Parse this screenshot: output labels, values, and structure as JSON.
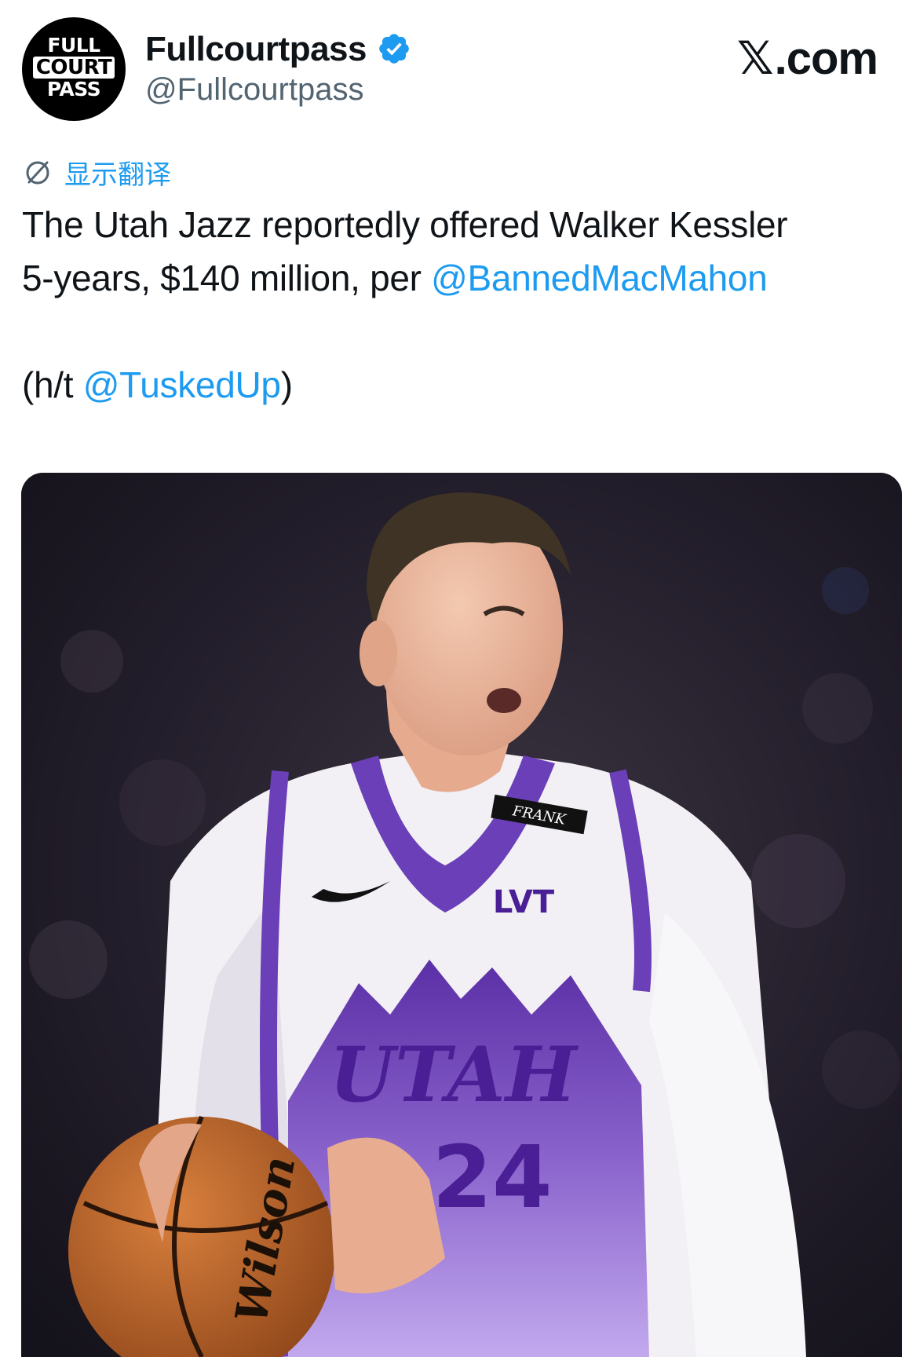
{
  "header": {
    "avatar_lines": [
      "FULL",
      "COURT",
      "PASS"
    ],
    "display_name": "Fullcourtpass",
    "handle": "@Fullcourtpass",
    "brand": ".com",
    "brand_x": "𝕏"
  },
  "translate": {
    "label": "显示翻译"
  },
  "tweet": {
    "line1": "The Utah Jazz reportedly offered Walker Kessler",
    "line2_prefix": "5-years, $140 million, per ",
    "mention1": "@BannedMacMahon",
    "line3_prefix": "(h/t ",
    "mention2": "@TuskedUp",
    "line3_suffix": ")"
  },
  "media": {
    "jersey_team": "UTAH",
    "jersey_number": "24",
    "sponsor": "LVT",
    "armband": "FRANK",
    "ball_brand": "Wilson"
  },
  "colors": {
    "accent": "#1d9bf0",
    "text": "#0f1419",
    "secondary": "#536471",
    "jersey_purple": "#6a3fb8"
  },
  "icons": [
    "verified-badge-icon",
    "translate-globe-icon"
  ]
}
